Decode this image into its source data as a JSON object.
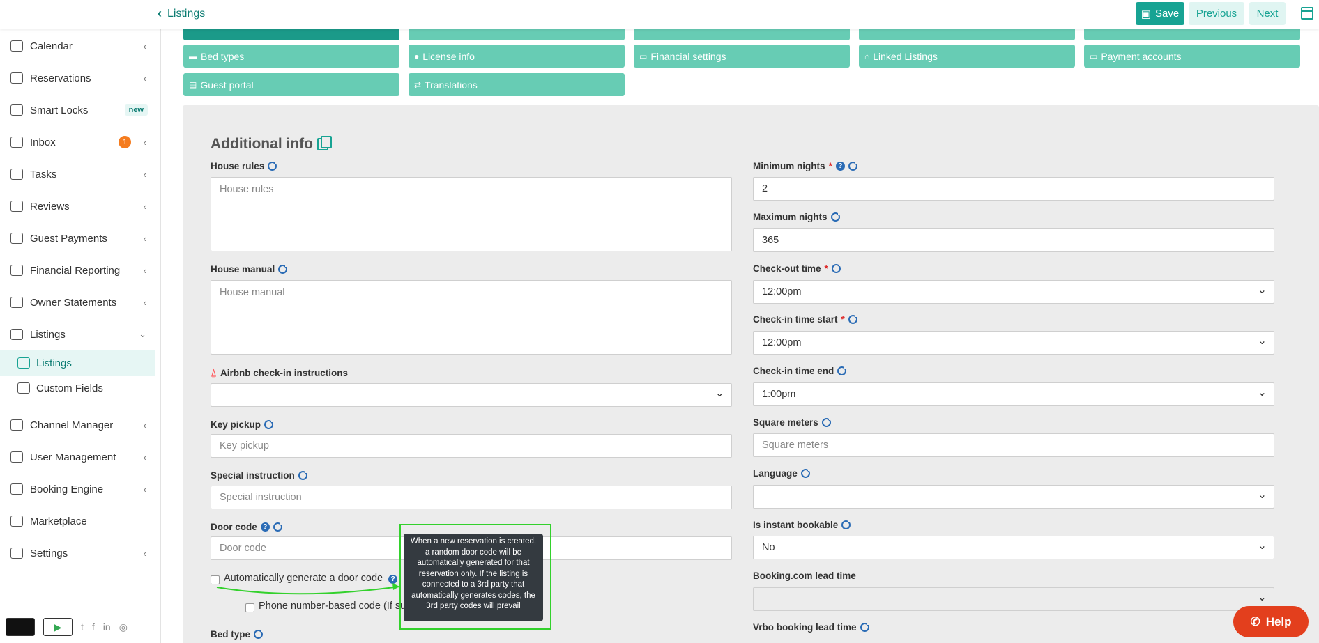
{
  "header": {
    "back_label": "Listings",
    "save_label": "Save",
    "previous_label": "Previous",
    "next_label": "Next"
  },
  "sidebar": {
    "items": [
      {
        "label": "Calendar",
        "icon": "calendar-icon"
      },
      {
        "label": "Reservations",
        "icon": "calendar-check-icon"
      },
      {
        "label": "Smart Locks",
        "icon": "key-icon",
        "badge": "new"
      },
      {
        "label": "Inbox",
        "icon": "inbox-icon",
        "count": "1"
      },
      {
        "label": "Tasks",
        "icon": "briefcase-icon"
      },
      {
        "label": "Reviews",
        "icon": "star-icon"
      },
      {
        "label": "Guest Payments",
        "icon": "credit-card-icon"
      },
      {
        "label": "Financial Reporting",
        "icon": "money-icon"
      },
      {
        "label": "Owner Statements",
        "icon": "statement-icon"
      },
      {
        "label": "Listings",
        "icon": "list-icon"
      },
      {
        "label": "Listings",
        "icon": "list-icon"
      },
      {
        "label": "Custom Fields",
        "icon": "gem-icon"
      },
      {
        "label": "Channel Manager",
        "icon": "plug-icon"
      },
      {
        "label": "User Management",
        "icon": "user-icon"
      },
      {
        "label": "Booking Engine",
        "icon": "layout-icon"
      },
      {
        "label": "Marketplace",
        "icon": "marketplace-icon"
      },
      {
        "label": "Settings",
        "icon": "gear-icon"
      }
    ]
  },
  "tabs": {
    "row1": [
      "Bed types",
      "License info",
      "Financial settings",
      "Linked Listings",
      "Payment accounts"
    ],
    "row2": [
      "Guest portal",
      "Translations"
    ]
  },
  "form": {
    "title": "Additional info",
    "house_rules": {
      "label": "House rules",
      "placeholder": "House rules"
    },
    "house_manual": {
      "label": "House manual",
      "placeholder": "House manual"
    },
    "airbnb_checkin": {
      "label": "Airbnb check-in instructions",
      "value": ""
    },
    "key_pickup": {
      "label": "Key pickup",
      "placeholder": "Key pickup"
    },
    "special_instruction": {
      "label": "Special instruction",
      "placeholder": "Special instruction"
    },
    "door_code": {
      "label": "Door code",
      "placeholder": "Door code"
    },
    "auto_door_code": {
      "label": "Automatically generate a door code"
    },
    "phone_code": {
      "label": "Phone number-based code (If su"
    },
    "bed_type": {
      "label": "Bed type"
    },
    "min_nights": {
      "label": "Minimum nights",
      "value": "2"
    },
    "max_nights": {
      "label": "Maximum nights",
      "value": "365"
    },
    "checkout_time": {
      "label": "Check-out time",
      "value": "12:00pm"
    },
    "checkin_start": {
      "label": "Check-in time start",
      "value": "12:00pm"
    },
    "checkin_end": {
      "label": "Check-in time end",
      "value": "1:00pm"
    },
    "square_meters": {
      "label": "Square meters",
      "placeholder": "Square meters"
    },
    "language": {
      "label": "Language",
      "value": ""
    },
    "instant_bookable": {
      "label": "Is instant bookable",
      "value": "No"
    },
    "booking_lead": {
      "label": "Booking.com lead time",
      "value": ""
    },
    "vrbo_lead": {
      "label": "Vrbo booking lead time"
    }
  },
  "tooltip": {
    "text": "When a new reservation is created, a random door code will be automatically generated for that reservation only. If the listing is connected to a 3rd party that automatically generates codes, the 3rd party codes will prevail"
  },
  "help": {
    "label": "Help"
  },
  "colors": {
    "accent": "#17a393",
    "tab": "#67ccb4",
    "help": "#e33f1d",
    "tooltip_frame": "#33d12c"
  }
}
